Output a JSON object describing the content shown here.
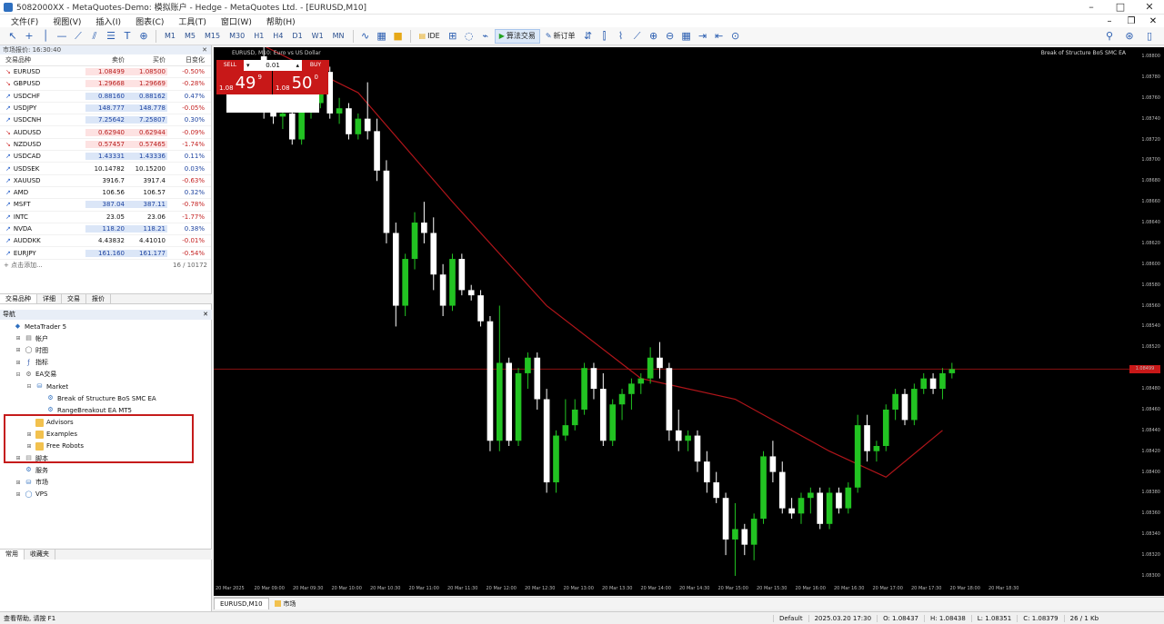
{
  "window": {
    "title": "5082000XX - MetaQuotes-Demo: 模拟账户 - Hedge - MetaQuotes Ltd. - [EURUSD,M10]"
  },
  "menu": [
    "文件(F)",
    "视图(V)",
    "插入(I)",
    "图表(C)",
    "工具(T)",
    "窗口(W)",
    "帮助(H)"
  ],
  "toolbar": {
    "timeframes": [
      "M1",
      "M5",
      "M15",
      "M30",
      "H1",
      "H4",
      "D1",
      "W1",
      "MN"
    ],
    "ide_label": "IDE",
    "algo_label": "算法交易",
    "new_order_label": "新订单"
  },
  "market_watch": {
    "header": "市场报价: 16:30:40",
    "columns": {
      "symbol": "交易品种",
      "bid": "卖价",
      "ask": "买价",
      "change": "日变化"
    },
    "rows": [
      {
        "symbol": "EURUSD",
        "bid": "1.08499",
        "ask": "1.08500",
        "change": "-0.50%",
        "dir": "down"
      },
      {
        "symbol": "GBPUSD",
        "bid": "1.29668",
        "ask": "1.29669",
        "change": "-0.28%",
        "dir": "down"
      },
      {
        "symbol": "USDCHF",
        "bid": "0.88160",
        "ask": "0.88162",
        "change": "0.47%",
        "dir": "up"
      },
      {
        "symbol": "USDJPY",
        "bid": "148.777",
        "ask": "148.778",
        "change": "-0.05%",
        "dir": "up"
      },
      {
        "symbol": "USDCNH",
        "bid": "7.25642",
        "ask": "7.25807",
        "change": "0.30%",
        "dir": "up"
      },
      {
        "symbol": "AUDUSD",
        "bid": "0.62940",
        "ask": "0.62944",
        "change": "-0.09%",
        "dir": "down"
      },
      {
        "symbol": "NZDUSD",
        "bid": "0.57457",
        "ask": "0.57465",
        "change": "-1.74%",
        "dir": "down"
      },
      {
        "symbol": "USDCAD",
        "bid": "1.43331",
        "ask": "1.43336",
        "change": "0.11%",
        "dir": "up"
      },
      {
        "symbol": "USDSEK",
        "bid": "10.14782",
        "ask": "10.15200",
        "change": "0.03%",
        "dir": "none"
      },
      {
        "symbol": "XAUUSD",
        "bid": "3916.7",
        "ask": "3917.4",
        "change": "-0.63%",
        "dir": "none"
      },
      {
        "symbol": "AMD",
        "bid": "106.56",
        "ask": "106.57",
        "change": "0.32%",
        "dir": "none"
      },
      {
        "symbol": "MSFT",
        "bid": "387.04",
        "ask": "387.11",
        "change": "-0.78%",
        "dir": "up"
      },
      {
        "symbol": "INTC",
        "bid": "23.05",
        "ask": "23.06",
        "change": "-1.77%",
        "dir": "none"
      },
      {
        "symbol": "NVDA",
        "bid": "118.20",
        "ask": "118.21",
        "change": "0.38%",
        "dir": "up"
      },
      {
        "symbol": "AUDDKK",
        "bid": "4.43832",
        "ask": "4.41010",
        "change": "-0.01%",
        "dir": "none"
      },
      {
        "symbol": "EURJPY",
        "bid": "161.160",
        "ask": "161.177",
        "change": "-0.54%",
        "dir": "up"
      }
    ],
    "add_label": "+ 点击添加...",
    "count": "16 / 10172",
    "tabs": [
      "交易品种",
      "详细",
      "交易",
      "报价"
    ]
  },
  "navigator": {
    "header": "导航",
    "items": [
      {
        "label": "MetaTrader 5",
        "level": 0,
        "icon": "app",
        "exp": ""
      },
      {
        "label": "帐户",
        "level": 1,
        "icon": "account",
        "exp": "+"
      },
      {
        "label": "时图",
        "level": 1,
        "icon": "signal",
        "exp": "+"
      },
      {
        "label": "指标",
        "level": 1,
        "icon": "indicator",
        "exp": "+"
      },
      {
        "label": "EA交易",
        "level": 1,
        "icon": "expert",
        "exp": "-"
      },
      {
        "label": "Market",
        "level": 2,
        "icon": "market",
        "exp": "-"
      },
      {
        "label": "Break of Structure BoS SMC EA",
        "level": 3,
        "icon": "ea",
        "exp": ""
      },
      {
        "label": "RangeBreakout EA MT5",
        "level": 3,
        "icon": "ea",
        "exp": ""
      },
      {
        "label": "Advisors",
        "level": 2,
        "icon": "folder",
        "exp": ""
      },
      {
        "label": "Examples",
        "level": 2,
        "icon": "folder",
        "exp": "+"
      },
      {
        "label": "Free Robots",
        "level": 2,
        "icon": "folder",
        "exp": "+"
      },
      {
        "label": "脚本",
        "level": 1,
        "icon": "script",
        "exp": "+"
      },
      {
        "label": "服务",
        "level": 1,
        "icon": "service",
        "exp": ""
      },
      {
        "label": "市场",
        "level": 1,
        "icon": "market2",
        "exp": "+"
      },
      {
        "label": "VPS",
        "level": 1,
        "icon": "vps",
        "exp": "+"
      }
    ],
    "tabs": [
      "常用",
      "收藏夹"
    ]
  },
  "chart": {
    "caption": "EURUSD, M10: Euro vs US Dollar",
    "ea_label": "Break of Structure BoS SMC EA",
    "trade_panel": {
      "sell_label": "SELL",
      "buy_label": "BUY",
      "lot": "0.01",
      "sell_prefix": "1.08",
      "sell_big": "49",
      "sell_sup": "9",
      "buy_prefix": "1.08",
      "buy_big": "50",
      "buy_sup": "0"
    },
    "current_price": "1.08499",
    "price_levels": [
      "1.08800",
      "1.08780",
      "1.08760",
      "1.08740",
      "1.08720",
      "1.08700",
      "1.08680",
      "1.08660",
      "1.08640",
      "1.08620",
      "1.08600",
      "1.08580",
      "1.08560",
      "1.08540",
      "1.08520",
      "1.08500",
      "1.08480",
      "1.08460",
      "1.08440",
      "1.08420",
      "1.08400",
      "1.08380",
      "1.08360",
      "1.08340",
      "1.08320",
      "1.08300"
    ],
    "time_labels": [
      "20 Mar 2025",
      "20 Mar 09:00",
      "20 Mar 09:30",
      "20 Mar 10:00",
      "20 Mar 10:30",
      "20 Mar 11:00",
      "20 Mar 11:30",
      "20 Mar 12:00",
      "20 Mar 12:30",
      "20 Mar 13:00",
      "20 Mar 13:30",
      "20 Mar 14:00",
      "20 Mar 14:30",
      "20 Mar 15:00",
      "20 Mar 15:30",
      "20 Mar 16:00",
      "20 Mar 16:30",
      "20 Mar 17:00",
      "20 Mar 17:30",
      "20 Mar 18:00",
      "20 Mar 18:30"
    ],
    "tabs": [
      "EURUSD,M10",
      "市场"
    ],
    "colors": {
      "bull": "#22c322",
      "bear": "#ffffff",
      "ma": "#b0151a",
      "bg": "#000000",
      "price_line": "#8a1010"
    }
  },
  "chart_data": {
    "type": "candlestick",
    "y_range": [
      1.083,
      1.088
    ],
    "current": 1.08499,
    "candles": [
      [
        1.088,
        1.0882,
        1.0874,
        1.0875
      ],
      [
        1.0875,
        1.0876,
        1.08735,
        1.08742
      ],
      [
        1.08742,
        1.08748,
        1.0873,
        1.08745
      ],
      [
        1.08745,
        1.0875,
        1.08715,
        1.0872
      ],
      [
        1.0872,
        1.08752,
        1.08715,
        1.08748
      ],
      [
        1.08748,
        1.0876,
        1.0874,
        1.08755
      ],
      [
        1.08755,
        1.0879,
        1.0875,
        1.08785
      ],
      [
        1.08785,
        1.0879,
        1.0874,
        1.08745
      ],
      [
        1.08745,
        1.0876,
        1.08735,
        1.0875
      ],
      [
        1.0875,
        1.08755,
        1.0872,
        1.08725
      ],
      [
        1.08725,
        1.08745,
        1.0872,
        1.0874
      ],
      [
        1.0874,
        1.08775,
        1.0872,
        1.08728
      ],
      [
        1.08728,
        1.0874,
        1.0868,
        1.0869
      ],
      [
        1.0869,
        1.087,
        1.0862,
        1.0863
      ],
      [
        1.0863,
        1.0864,
        1.0854,
        1.0856
      ],
      [
        1.0856,
        1.0861,
        1.0855,
        1.08605
      ],
      [
        1.08605,
        1.0865,
        1.08595,
        1.0864
      ],
      [
        1.0864,
        1.0866,
        1.0862,
        1.0863
      ],
      [
        1.0863,
        1.08645,
        1.08575,
        1.0859
      ],
      [
        1.0859,
        1.086,
        1.0855,
        1.0856
      ],
      [
        1.0856,
        1.0861,
        1.08555,
        1.08605
      ],
      [
        1.08605,
        1.0861,
        1.0857,
        1.08575
      ],
      [
        1.08575,
        1.0858,
        1.08565,
        1.0857
      ],
      [
        1.0857,
        1.08575,
        1.0854,
        1.08545
      ],
      [
        1.08545,
        1.0855,
        1.0842,
        1.0843
      ],
      [
        1.0843,
        1.0856,
        1.0842,
        1.08505
      ],
      [
        1.08505,
        1.0851,
        1.08425,
        1.0843
      ],
      [
        1.0843,
        1.085,
        1.08425,
        1.08495
      ],
      [
        1.08495,
        1.08515,
        1.0848,
        1.0851
      ],
      [
        1.0851,
        1.08515,
        1.0846,
        1.0847
      ],
      [
        1.0847,
        1.0848,
        1.0838,
        1.0839
      ],
      [
        1.0839,
        1.0844,
        1.0838,
        1.08435
      ],
      [
        1.08435,
        1.0847,
        1.0843,
        1.08445
      ],
      [
        1.08445,
        1.0847,
        1.0844,
        1.0846
      ],
      [
        1.0846,
        1.08505,
        1.08455,
        1.085
      ],
      [
        1.085,
        1.08505,
        1.0847,
        1.0848
      ],
      [
        1.0848,
        1.08495,
        1.08425,
        1.0843
      ],
      [
        1.0843,
        1.0847,
        1.08425,
        1.08465
      ],
      [
        1.08465,
        1.0848,
        1.0845,
        1.08475
      ],
      [
        1.08475,
        1.0849,
        1.0846,
        1.08485
      ],
      [
        1.08485,
        1.08495,
        1.08475,
        1.0849
      ],
      [
        1.0849,
        1.0852,
        1.08485,
        1.0851
      ],
      [
        1.0851,
        1.08525,
        1.0849,
        1.085
      ],
      [
        1.085,
        1.08505,
        1.0843,
        1.0844
      ],
      [
        1.0844,
        1.0846,
        1.0842,
        1.0843
      ],
      [
        1.0843,
        1.0844,
        1.0842,
        1.08435
      ],
      [
        1.08435,
        1.0844,
        1.084,
        1.0841
      ],
      [
        1.0841,
        1.0842,
        1.0838,
        1.0839
      ],
      [
        1.0839,
        1.084,
        1.0837,
        1.08375
      ],
      [
        1.08375,
        1.0838,
        1.0832,
        1.08335
      ],
      [
        1.08335,
        1.0837,
        1.083,
        1.08345
      ],
      [
        1.08345,
        1.0835,
        1.0832,
        1.0833
      ],
      [
        1.0833,
        1.0836,
        1.08315,
        1.08355
      ],
      [
        1.08355,
        1.0842,
        1.0835,
        1.08415
      ],
      [
        1.08415,
        1.0843,
        1.0839,
        1.084
      ],
      [
        1.084,
        1.0841,
        1.0836,
        1.08365
      ],
      [
        1.08365,
        1.08375,
        1.08355,
        1.0836
      ],
      [
        1.0836,
        1.0838,
        1.0835,
        1.08375
      ],
      [
        1.08375,
        1.08385,
        1.0836,
        1.0838
      ],
      [
        1.0838,
        1.08385,
        1.08345,
        1.0835
      ],
      [
        1.0835,
        1.08385,
        1.08345,
        1.0838
      ],
      [
        1.0838,
        1.08385,
        1.0836,
        1.08365
      ],
      [
        1.08365,
        1.0839,
        1.0836,
        1.08385
      ],
      [
        1.08385,
        1.08455,
        1.0838,
        1.08445
      ],
      [
        1.08445,
        1.08455,
        1.0841,
        1.0842
      ],
      [
        1.0842,
        1.0843,
        1.0841,
        1.08425
      ],
      [
        1.08425,
        1.08465,
        1.0842,
        1.0846
      ],
      [
        1.0846,
        1.0848,
        1.0845,
        1.08475
      ],
      [
        1.08475,
        1.0848,
        1.08445,
        1.0845
      ],
      [
        1.0845,
        1.08485,
        1.08445,
        1.0848
      ],
      [
        1.0848,
        1.08495,
        1.08475,
        1.0849
      ],
      [
        1.0849,
        1.08495,
        1.08475,
        1.0848
      ],
      [
        1.0848,
        1.085,
        1.0847,
        1.08495
      ],
      [
        1.08495,
        1.08505,
        1.0849,
        1.08499
      ]
    ],
    "ma_points": [
      [
        0,
        1.0881
      ],
      [
        10,
        1.08765
      ],
      [
        20,
        1.0866
      ],
      [
        30,
        1.0856
      ],
      [
        40,
        1.0849
      ],
      [
        50,
        1.0847
      ],
      [
        60,
        1.0842
      ],
      [
        66,
        1.08395
      ],
      [
        72,
        1.0844
      ]
    ]
  }
}
